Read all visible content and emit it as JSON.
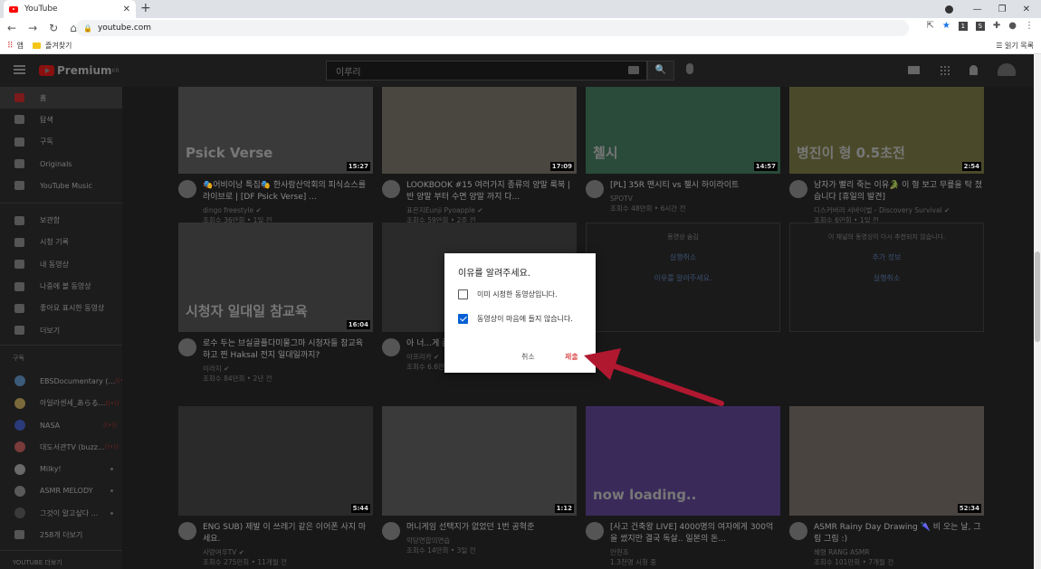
{
  "browser": {
    "tab_title": "YouTube",
    "url": "youtube.com",
    "bookmarks": {
      "apps": "앱",
      "folder": "즐겨찾기",
      "reading_list": "읽기 목록"
    }
  },
  "masthead": {
    "logo": "Premium",
    "logo_sup": "KR",
    "search_value": "이루리"
  },
  "sidebar": {
    "main": [
      {
        "label": "홈",
        "icon": "home-icon"
      },
      {
        "label": "탐색",
        "icon": "explore-icon"
      },
      {
        "label": "구독",
        "icon": "subscriptions-icon"
      },
      {
        "label": "Originals",
        "icon": "originals-icon"
      },
      {
        "label": "YouTube Music",
        "icon": "music-icon"
      }
    ],
    "library": [
      {
        "label": "보관함",
        "icon": "library-icon"
      },
      {
        "label": "시청 기록",
        "icon": "history-icon"
      },
      {
        "label": "내 동영상",
        "icon": "your-videos-icon"
      },
      {
        "label": "나중에 볼 동영상",
        "icon": "watch-later-icon"
      },
      {
        "label": "좋아요 표시한 동영상",
        "icon": "liked-icon"
      },
      {
        "label": "더보기",
        "icon": "chevron-down-icon"
      }
    ],
    "subs_header": "구독",
    "subs": [
      {
        "label": "EBSDocumentary (...",
        "color": "#3c5a7a",
        "live": "((•))"
      },
      {
        "label": "아일라센세_あらる...",
        "color": "#7a6a3a",
        "live": "((•))"
      },
      {
        "label": "NASA",
        "color": "#2a3a7a",
        "live": "((•))"
      },
      {
        "label": "대도서관TV (buzz...",
        "color": "#7a3a3a",
        "live": "((•))"
      },
      {
        "label": "Milky!",
        "color": "#6a6a6a"
      },
      {
        "label": "ASMR MELODY",
        "color": "#5a5a5a"
      },
      {
        "label": "그것이 알고싶다 ...",
        "color": "#3a3a3a"
      },
      {
        "label": "258개 더보기",
        "icon": "chevron-down-icon"
      }
    ],
    "footer_header": "YOUTUBE 더보기"
  },
  "videos": [
    {
      "title": "🎭어비이낭 특집🎭 한사람산악회의 피식쇼스를 라이브로 | [DF Psick Verse] ...",
      "channel": "dingo freestyle ✔",
      "meta": "조회수 36만회 • 1일 전",
      "duration": "15:27",
      "thumb_text": "Psick Verse",
      "color": "#3a3a3a"
    },
    {
      "title": "LOOKBOOK #15 여러가지 종류의 양말 룩북 | 반 양말 부터 수면 양말 까지 다...",
      "channel": "표은지Eunji Pyoapple ✔",
      "meta": "조회수 59만회 • 2주 전",
      "duration": "17:09",
      "color": "#4a4640"
    },
    {
      "title": "[PL] 35R 맨시티 vs 첼시 하이라이트",
      "channel": "SPOTV",
      "meta": "조회수 48만회 • 6시간 전",
      "duration": "14:57",
      "thumb_text": "첼시",
      "color": "#2a4a3a"
    },
    {
      "title": "남자가 빨리 죽는 이유🐊 이 형 보고 무릎을 탁 쳤습니다 [휴일의 발견]",
      "channel": "디스커버리 서바이벌 - Discovery Survival ✔",
      "meta": "조회수 6만회 • 1일 전",
      "duration": "2:54",
      "thumb_text": "병진이 형 0.5초전",
      "color": "#4a4a2a"
    },
    {
      "title": "로수 두는 브실골플다미물그마 시청자들 참교육 하고 찐 Haksal 전지 일대일까지?",
      "channel": "이라지 ✔",
      "meta": "조회수 84만회 • 2년 전",
      "duration": "16:04",
      "thumb_text": "시청자 일대일 참교육",
      "color": "#333"
    },
    {
      "title": "아 너...게 존11 8강...",
      "channel": "아프리카 ✔",
      "meta": "조회수 6.6만회 • 3시간 전",
      "duration": "",
      "color": "#2a2a2a"
    },
    {
      "title": "ENG SUB) 제발 이 쓰레기 같은 이어폰 사지 마세요.",
      "channel": "사망여우TV ✔",
      "meta": "조회수 275만회 • 11개월 전",
      "duration": "5:44",
      "color": "#2a2a2a"
    },
    {
      "title": "머니게임 선택지가 없었던 1번 공혁준",
      "channel": "악당연합의연습",
      "meta": "조회수 14만회 • 3일 전",
      "duration": "1:12",
      "color": "#3a3a3a"
    },
    {
      "title": "[사고 건축왕 LIVE] 4000명의 여자에게 300억을 썼지만 결국 독살.. 일본의 돈...",
      "channel": "안현조",
      "meta": "1.3천명 시청 중",
      "duration": "",
      "thumb_text": "now loading..",
      "color": "#3a2a5a"
    },
    {
      "title": "ASMR Rainy Day Drawing 🌂 비 오는 날, 그림 그림 :)",
      "channel": "혜령 RANG ASMR",
      "meta": "조회수 101만회 • 7개월 전",
      "duration": "52:34",
      "color": "#4a4440"
    }
  ],
  "hidden_cards": [
    {
      "l1": "동영상 숨김",
      "l2": "실행취소",
      "l3": "이유를 알려주세요."
    },
    {
      "l1": "이 채널의 동영상이 다시 추천되지 않습니다.",
      "l2": "추가 정보",
      "l3": "실행취소"
    }
  ],
  "dialog": {
    "title": "이유를 알려주세요.",
    "options": [
      {
        "label": "이미 시청한 동영상입니다.",
        "checked": false
      },
      {
        "label": "동영상이 마음에 들지 않습니다.",
        "checked": true
      }
    ],
    "cancel": "취소",
    "submit": "제출"
  },
  "colors": {
    "accent_red": "#cc0000",
    "checkbox_blue": "#065fd4",
    "arrow": "#b01830"
  }
}
